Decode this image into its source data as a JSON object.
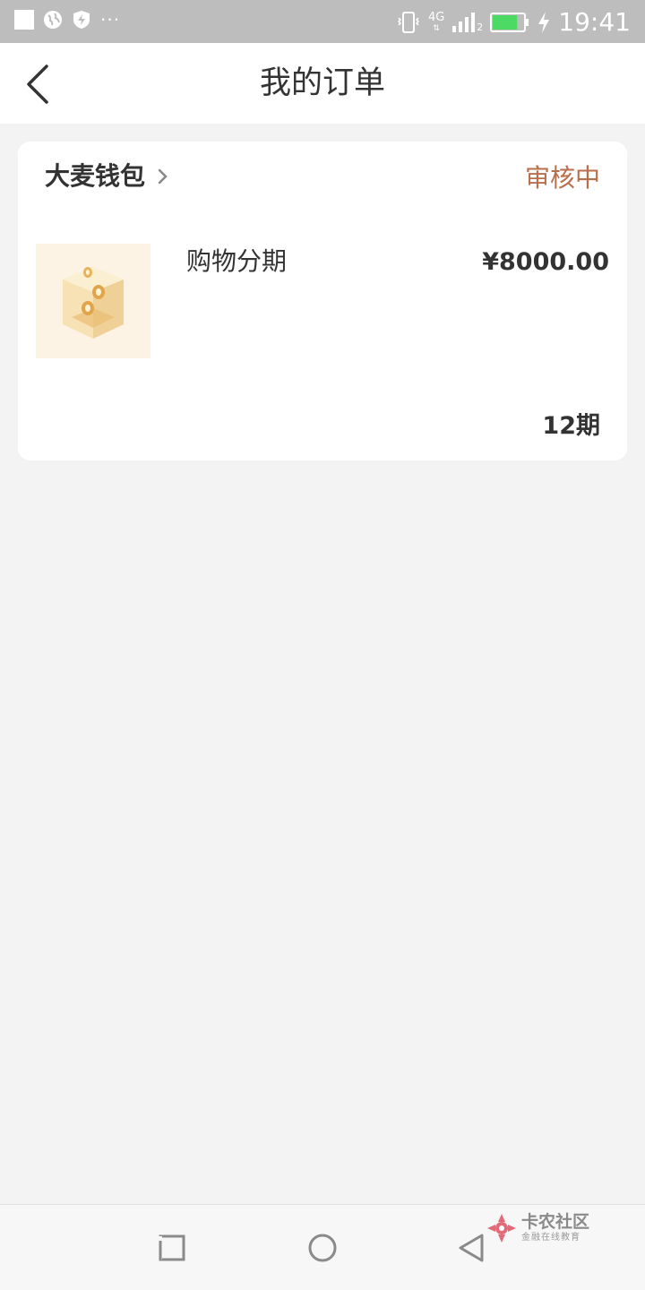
{
  "status_bar": {
    "network": "4G",
    "sim": "2",
    "time": "19:41",
    "battery_level": 0.8,
    "icons": [
      "square-icon",
      "globe-icon",
      "shield-bolt-icon",
      "more-dots-icon",
      "vibrate-icon",
      "signal-icon",
      "battery-icon",
      "charging-icon"
    ],
    "more": "···"
  },
  "header": {
    "title": "我的订单",
    "back_icon": "chevron-left-icon"
  },
  "order": {
    "merchant": "大麦钱包",
    "status": "审核中",
    "status_color": "#b86f4b",
    "product_name": "购物分期",
    "price": "¥8000.00",
    "installments": "12期",
    "thumb_icon": "coin-box-icon"
  },
  "bottom_nav": {
    "buttons": [
      "recent-apps-icon",
      "home-icon",
      "back-icon"
    ]
  },
  "watermark": {
    "title": "卡农社区",
    "subtitle": "金融在线教育"
  }
}
